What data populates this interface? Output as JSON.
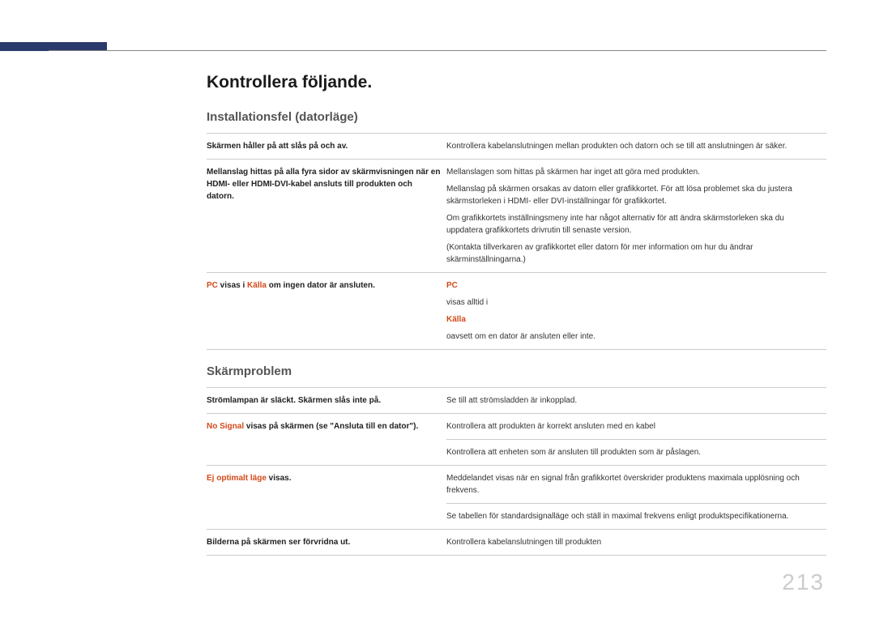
{
  "page_number": "213",
  "main_title": "Kontrollera följande.",
  "sections": [
    {
      "title": "Installationsfel (datorläge)",
      "rows": [
        {
          "left": [
            {
              "text": "Skärmen håller på att slås på och av."
            }
          ],
          "right": [
            {
              "text": "Kontrollera kabelanslutningen mellan produkten och datorn och se till att anslutningen är säker."
            }
          ]
        },
        {
          "left": [
            {
              "text": "Mellanslag hittas på alla fyra sidor av skärmvisningen när en HDMI- eller HDMI-DVI-kabel ansluts till produkten och datorn."
            }
          ],
          "right": [
            {
              "text": "Mellanslagen som hittas på skärmen har inget att göra med produkten."
            },
            {
              "text": "Mellanslag på skärmen orsakas av datorn eller grafikkortet. För att lösa problemet ska du justera skärmstorleken i HDMI- eller DVI-inställningar för grafikkortet."
            },
            {
              "text": "Om grafikkortets inställningsmeny inte har något alternativ för att ändra skärmstorleken ska du uppdatera grafikkortets drivrutin till senaste version."
            },
            {
              "text": "(Kontakta tillverkaren av grafikkortet eller datorn för mer information om hur du ändrar skärminställningarna.)"
            }
          ]
        },
        {
          "left": [
            {
              "text": "PC",
              "orange": true
            },
            {
              "text": " visas i "
            },
            {
              "text": "Källa",
              "orange": true
            },
            {
              "text": " om ingen dator är ansluten."
            }
          ],
          "right": [
            {
              "text": "PC",
              "orange_inline": true
            },
            {
              "text": " visas alltid i "
            },
            {
              "text": "Källa",
              "orange_inline": true
            },
            {
              "text": " oavsett om en dator är ansluten eller inte."
            }
          ]
        }
      ]
    },
    {
      "title": "Skärmproblem",
      "rows": [
        {
          "left": [
            {
              "text": "Strömlampan är släckt. Skärmen slås inte på."
            }
          ],
          "right": [
            {
              "text": "Se till att strömsladden är inkopplad."
            }
          ]
        },
        {
          "left": [
            {
              "text": "No Signal",
              "orange": true
            },
            {
              "text": " visas på skärmen (se \"Ansluta till en dator\")."
            }
          ],
          "right": [
            {
              "text": "Kontrollera att produkten är korrekt ansluten med en kabel"
            },
            {
              "border": true,
              "text": "Kontrollera att enheten som är ansluten till produkten som är påslagen."
            }
          ]
        },
        {
          "left": [
            {
              "text": "Ej optimalt läge",
              "orange": true
            },
            {
              "text": " visas."
            }
          ],
          "right": [
            {
              "text": "Meddelandet visas när en signal från grafikkortet överskrider produktens maximala upplösning och frekvens."
            },
            {
              "border": true,
              "text": "Se tabellen för standardsignalläge och ställ in maximal frekvens enligt produktspecifikationerna."
            }
          ]
        },
        {
          "left": [
            {
              "text": "Bilderna på skärmen ser förvridna ut."
            }
          ],
          "right": [
            {
              "text": "Kontrollera kabelanslutningen till produkten"
            }
          ]
        }
      ]
    }
  ]
}
